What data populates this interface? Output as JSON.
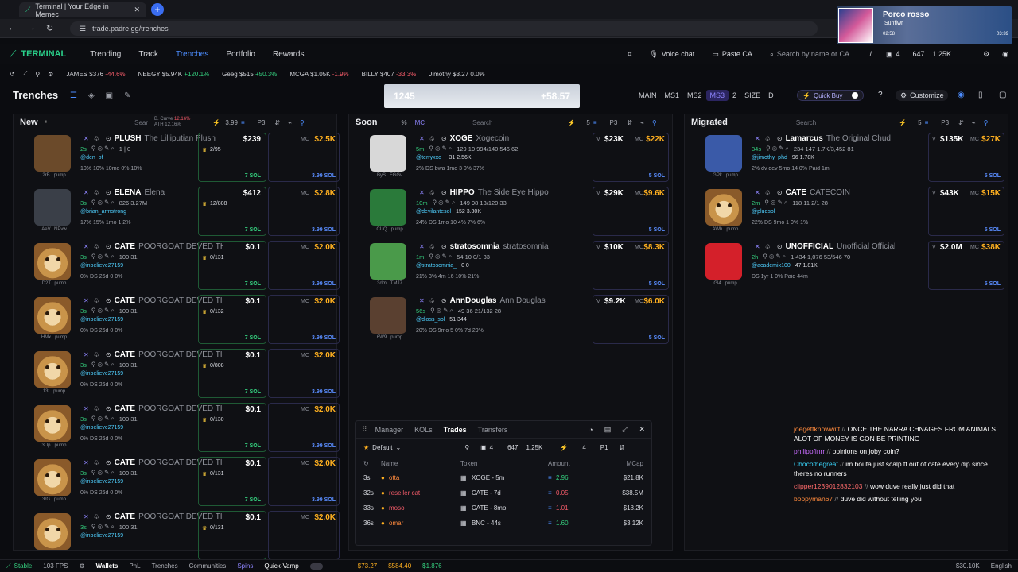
{
  "browser": {
    "tab_title": "Terminal | Your Edge in Memec",
    "url": "trade.padre.gg/trenches"
  },
  "stream": {
    "streamer_name": "Porco rosso",
    "streamer_sub": "Sunflwr",
    "time_left": "02:58",
    "time_right": "03:39"
  },
  "nav": {
    "logo": "TERMINAL",
    "items": [
      "Trending",
      "Track",
      "Trenches",
      "Portfolio",
      "Rewards"
    ],
    "active": "Trenches",
    "voice_chat": "Voice chat",
    "paste_ca": "Paste CA",
    "search_placeholder": "Search by name or CA...",
    "search_shortcut": "/",
    "wallet_count": "4",
    "stat_a": "647",
    "stat_b": "1.25K"
  },
  "ticker": [
    {
      "name": "JAMES",
      "value": "$376",
      "change": "-44.6%",
      "dir": "dn"
    },
    {
      "name": "NEEGY",
      "value": "$5.94K",
      "change": "+120.1%",
      "dir": "up"
    },
    {
      "name": "Geeg",
      "value": "$515",
      "change": "+50.3%",
      "dir": "up"
    },
    {
      "name": "MCGA",
      "value": "$1.05K",
      "change": "-1.9%",
      "dir": "dn"
    },
    {
      "name": "BILLY",
      "value": "$407",
      "change": "-33.3%",
      "dir": "dn"
    },
    {
      "name": "Jimothy",
      "value": "$3.27",
      "change": "0.0%",
      "dir": "flat"
    }
  ],
  "trenches": {
    "title": "Trenches",
    "banner_left": "1245",
    "banner_right": "+58.57",
    "segments": [
      "MAIN",
      "MS1",
      "MS2",
      "MS3",
      "2",
      "SIZE",
      "D"
    ],
    "active_segment": "MS3",
    "quick_buy": "Quick Buy",
    "customize": "Customize"
  },
  "columns": {
    "new": {
      "title": "New",
      "search": "Sear",
      "curve_label": "B. Curve",
      "curve_value": "12.16%",
      "ath_label": "ATH",
      "ath_value": "12.16%",
      "amount": "3.99",
      "preset": "P3"
    },
    "soon": {
      "title": "Soon",
      "percent_tab": "%",
      "mc_tab": "MC",
      "search": "Search",
      "amount": "5",
      "preset": "P3"
    },
    "migrated": {
      "title": "Migrated",
      "search": "Search",
      "amount": "5",
      "preset": "P3"
    }
  },
  "new_cards": [
    {
      "sym": "PLUSH",
      "name": "The Lilliputian Plush",
      "age": "2s",
      "handle": "@den_of_",
      "cap": "2rB...pump",
      "v": "$239",
      "mc": "$2.5K",
      "stats": "1 | 0",
      "cup": "2/95",
      "l4": "10%  10%  10mo  0%  10%",
      "sol": "3.99 SOL",
      "solg": "7 SOL"
    },
    {
      "sym": "ELENA",
      "name": "Elena",
      "age": "3s",
      "handle": "@brian_armstrong",
      "cap": "AeV...NPvw",
      "v": "$412",
      "mc": "$2.8K",
      "stats": "826  3.27M",
      "cup": "12/808",
      "l4": "17%  15%  1mo  1  2%",
      "sol": "3.99 SOL",
      "solg": "7 SOL"
    },
    {
      "sym": "CATE",
      "name": "POORGOAT DEVED THIS CATE READ",
      "age": "3s",
      "handle": "@inbelieve27159",
      "cap": "D2T...pump",
      "v": "$0.1",
      "mc": "$2.0K",
      "stats": "100  31",
      "cup": "0/131",
      "l4": "0%  DS  26d  0  0%",
      "sol": "3.99 SOL",
      "solg": "7 SOL"
    },
    {
      "sym": "CATE",
      "name": "POORGOAT DEVED THIS CATE READ",
      "age": "3s",
      "handle": "@inbelieve27159",
      "cap": "HMx...pump",
      "v": "$0.1",
      "mc": "$2.0K",
      "stats": "100  31",
      "cup": "0/132",
      "l4": "0%  DS  26d  0  0%",
      "sol": "3.99 SOL",
      "solg": "7 SOL"
    },
    {
      "sym": "CATE",
      "name": "POORGOAT DEVED THIS CATE READ",
      "age": "3s",
      "handle": "@inbelieve27159",
      "cap": "13t...pump",
      "v": "$0.1",
      "mc": "$2.0K",
      "stats": "100  31",
      "cup": "0/808",
      "l4": "0%  DS  26d  0  0%",
      "sol": "3.99 SOL",
      "solg": "7 SOL"
    },
    {
      "sym": "CATE",
      "name": "POORGOAT DEVED THIS CATE READ",
      "age": "3s",
      "handle": "@inbelieve27159",
      "cap": "3Up...pump",
      "v": "$0.1",
      "mc": "$2.0K",
      "stats": "100  31",
      "cup": "0/130",
      "l4": "0%  DS  26d  0  0%",
      "sol": "3.99 SOL",
      "solg": "7 SOL"
    },
    {
      "sym": "CATE",
      "name": "POORGOAT DEVED THIS CATE READ",
      "age": "3s",
      "handle": "@inbelieve27159",
      "cap": "3rG...pump",
      "v": "$0.1",
      "mc": "$2.0K",
      "stats": "100  31",
      "cup": "0/131",
      "l4": "0%  DS  26d  0  0%",
      "sol": "3.99 SOL",
      "solg": "7 SOL"
    },
    {
      "sym": "CATE",
      "name": "POORGOAT DEVED THIS CATE READ",
      "age": "3s",
      "handle": "@inbelieve27159",
      "cap": "",
      "v": "$0.1",
      "mc": "$2.0K",
      "stats": "100  31",
      "cup": "0/131",
      "l4": "",
      "sol": "",
      "solg": ""
    }
  ],
  "soon_cards": [
    {
      "sym": "XOGE",
      "name": "Xogecoin",
      "age": "5m",
      "handle": "@terryxxc_",
      "cap": "ByS...FGGv",
      "v": "$23K",
      "mc": "$22K",
      "stats": "129  10  994/140,546  62",
      "sub": "31  2.56K",
      "l4": "2%  DS  bwa  1mo  3  0%  37%",
      "sol": "5 SOL"
    },
    {
      "sym": "HIPPO",
      "name": "The Side Eye Hippo",
      "age": "10m",
      "handle": "@devilantesol",
      "cap": "CUQ...pump",
      "v": "$29K",
      "mc": "$9.6K",
      "stats": "149  98  13/120  33",
      "sub": "152  3.30K",
      "l4": "24%  DS  1mo  10  4%  7%  6%",
      "sol": "5 SOL"
    },
    {
      "sym": "stratosomnia",
      "name": "stratosomnia",
      "age": "1m",
      "handle": "@stratosomnia_",
      "cap": "3dm...TMJ7",
      "v": "$10K",
      "mc": "$8.3K",
      "stats": "54  10  0/1  33",
      "sub": "0  0",
      "l4": "21%  3%  4m  16  10%  21%",
      "sol": "5 SOL"
    },
    {
      "sym": "AnnDouglas",
      "name": "Ann Douglas",
      "age": "56s",
      "handle": "@dioss_sol",
      "cap": "6W9...pump",
      "v": "$9.2K",
      "mc": "$6.0K",
      "stats": "49  36  21/132  28",
      "sub": "51  344",
      "l4": "20%  DS  9mo  5  0%  7d  29%",
      "sol": "5 SOL"
    }
  ],
  "migrated_cards": [
    {
      "sym": "Lamarcus",
      "name": "The Original Chud",
      "age": "34s",
      "handle": "@jimothy_phd",
      "cap": "GPk...pump",
      "v": "$135K",
      "mc": "$27K",
      "stats": "234  147  1.7K/3,452  81",
      "sub": "96  1.78K",
      "l4": "2%  dv dev 5mo  14  0%  Paid 1m",
      "sol": "5 SOL"
    },
    {
      "sym": "CATE",
      "name": "CATECOIN",
      "age": "2m",
      "handle": "@pluqsol",
      "cap": "AWh...pump",
      "v": "$43K",
      "mc": "$15K",
      "stats": "118  11  2/1  28",
      "sub": "",
      "l4": "22%  DS  9mo  1  0%  1%",
      "sol": "5 SOL"
    },
    {
      "sym": "UNOFFICIAL",
      "name": "Unofficial Official Coin",
      "age": "2h",
      "handle": "@academix100",
      "cap": "Gl4...pump",
      "v": "$2.0M",
      "mc": "$38K",
      "stats": "1,434  1,076  53/546  70",
      "sub": "47  1.81K",
      "l4": "DS  1yr  1  0%  Paid 44m",
      "sol": "5 SOL"
    }
  ],
  "trades_panel": {
    "tabs": [
      "Manager",
      "KOLs",
      "Trades",
      "Transfers"
    ],
    "active_tab": "Trades",
    "preset": "Default",
    "count_a": "4",
    "count_b": "647",
    "count_c": "1.25K",
    "count_d": "4",
    "preset_p": "P1",
    "headers": [
      "Name",
      "Token",
      "Amount",
      "MCap"
    ],
    "rows": [
      {
        "age": "3s",
        "name": "otta",
        "token": "XOGE - 5m",
        "amount": "2.96",
        "side": "buy",
        "mcap": "$21.8K"
      },
      {
        "age": "32s",
        "name": "reseller cat",
        "token": "CATE - 7d",
        "amount": "0.05",
        "side": "sell",
        "mcap": "$38.5M"
      },
      {
        "age": "33s",
        "name": "moso",
        "token": "CATE - 8mo",
        "amount": "1.01",
        "side": "sell",
        "mcap": "$18.2K"
      },
      {
        "age": "36s",
        "name": "omar",
        "token": "BNC - 44s",
        "amount": "1.60",
        "side": "buy",
        "mcap": "$3.12K"
      }
    ]
  },
  "chat": [
    {
      "user": "joegettknowwitt",
      "msg": "ONCE THE NARRA CHNAGES FROM ANIMALS ALOT OF MONEY IS GON BE PRINTING",
      "color": "#ff8a3d"
    },
    {
      "user": "philippfinrr",
      "msg": "opinions on joby coin?",
      "color": "#c86cff"
    },
    {
      "user": "Chocothegreat",
      "msg": "im bouta just scalp tf out of cate every dip since theres no runners",
      "color": "#39d8ff"
    },
    {
      "user": "clipper1239012832103",
      "msg": "wow duve really just did that",
      "color": "#ff6b6b"
    },
    {
      "user": "boopyman67",
      "msg": "duve did without telling you",
      "color": "#ff8a3d"
    }
  ],
  "status_bar": {
    "connection": "Stable",
    "fps": "103 FPS",
    "items": [
      "Wallets",
      "PnL",
      "Trenches",
      "Communities",
      "Spins",
      "Quick-Vamp"
    ],
    "btc": "$73.27",
    "eth": "$584.40",
    "sol": "$1.876",
    "balance": "$30.10K",
    "lang": "English"
  },
  "colors": {
    "accent": "#4c8dff",
    "up": "#35d07f",
    "down": "#f45b69",
    "mc": "#ffb020",
    "purple": "#8f86ff"
  }
}
